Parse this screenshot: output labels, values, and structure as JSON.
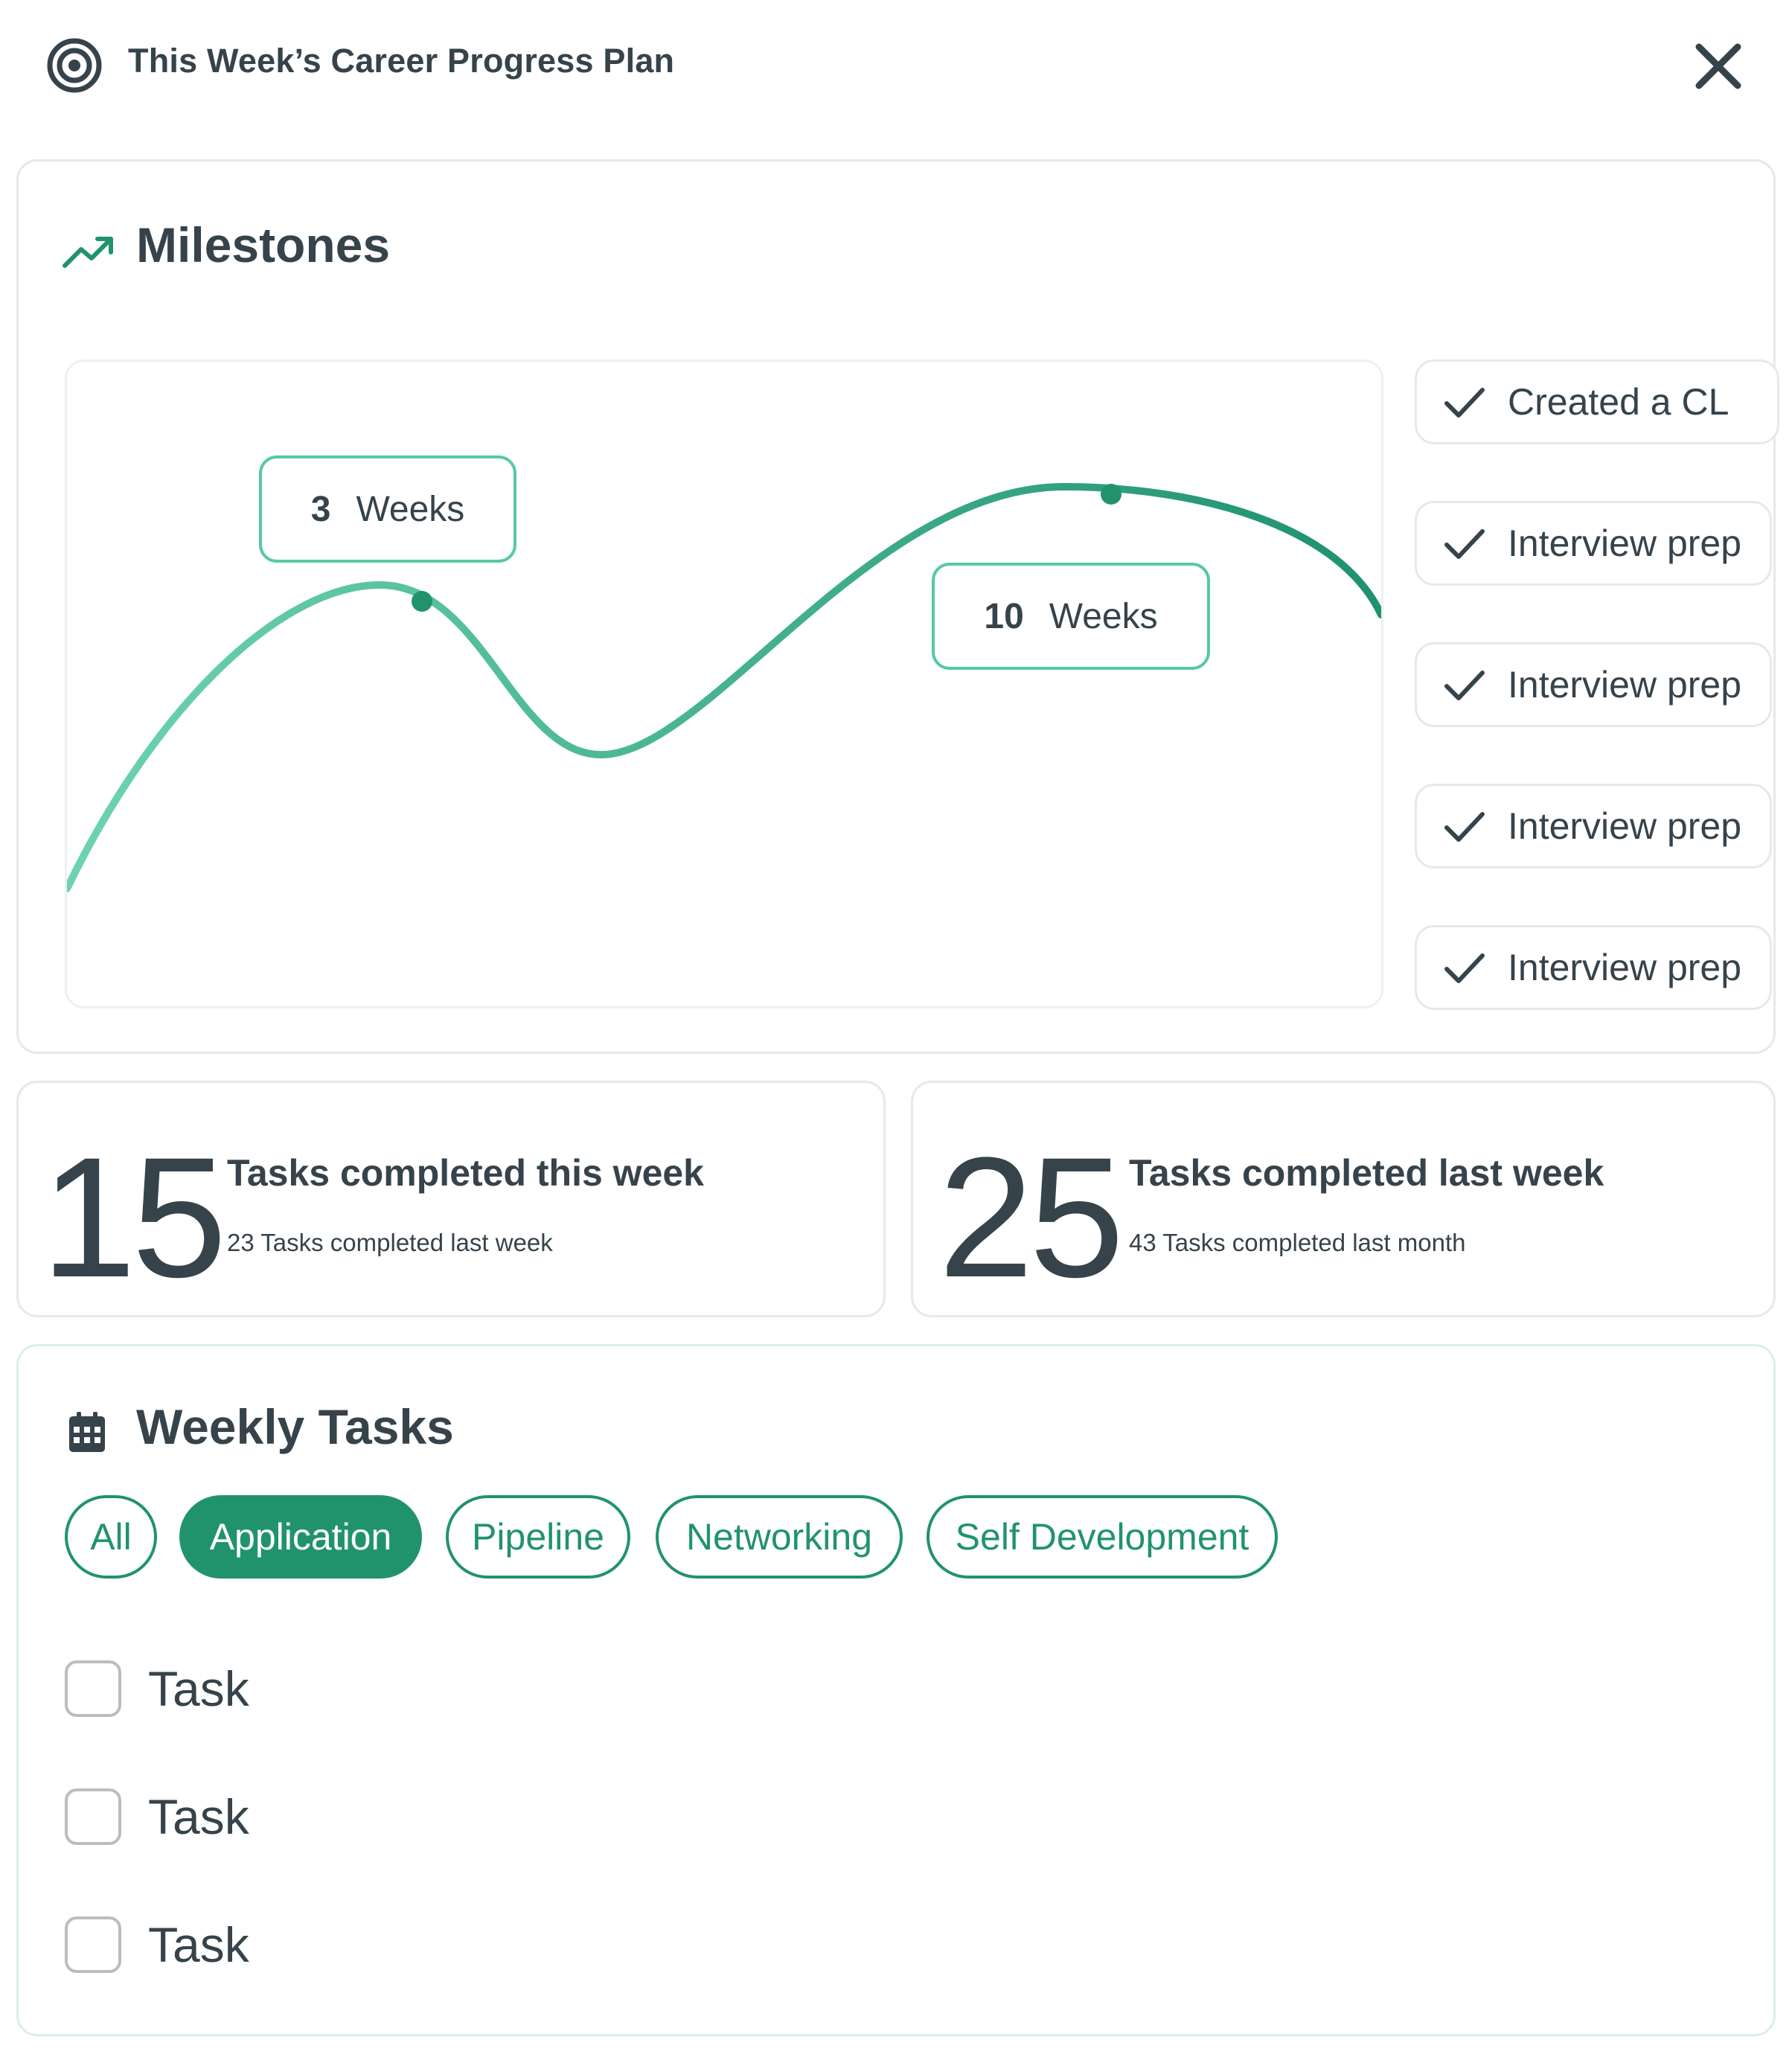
{
  "header": {
    "title": "This Week’s Career Progress Plan",
    "logo_icon": "target-icon",
    "close_icon": "close-icon"
  },
  "milestones": {
    "title": "Milestones",
    "icon": "trending-up-icon",
    "callouts": [
      {
        "number": "3",
        "unit": "Weeks"
      },
      {
        "number": "10",
        "unit": "Weeks"
      }
    ],
    "items": [
      {
        "label": "Created a CL",
        "icon": "check-icon"
      },
      {
        "label": "Interview prep",
        "icon": "check-icon"
      },
      {
        "label": "Interview prep",
        "icon": "check-icon"
      },
      {
        "label": "Interview prep",
        "icon": "check-icon"
      },
      {
        "label": "Interview prep",
        "icon": "check-icon"
      }
    ]
  },
  "stats": [
    {
      "value": "15",
      "title": "Tasks completed this week",
      "subtitle": "23 Tasks completed last week"
    },
    {
      "value": "25",
      "title": "Tasks completed last week",
      "subtitle": "43 Tasks completed last month"
    }
  ],
  "weekly": {
    "title": "Weekly Tasks",
    "icon": "calendar-icon",
    "filters": [
      {
        "label": "All",
        "active": false
      },
      {
        "label": "Application",
        "active": true
      },
      {
        "label": "Pipeline",
        "active": false
      },
      {
        "label": "Networking",
        "active": false
      },
      {
        "label": "Self Development",
        "active": false
      }
    ],
    "tasks": [
      {
        "label": "Task",
        "checked": false
      },
      {
        "label": "Task",
        "checked": false
      },
      {
        "label": "Task",
        "checked": false
      }
    ]
  },
  "colors": {
    "accent": "#21936c",
    "curve_light": "#6dd3b1",
    "curve_dark": "#1f9170",
    "text": "#36434b",
    "border": "#e6e8ea"
  }
}
